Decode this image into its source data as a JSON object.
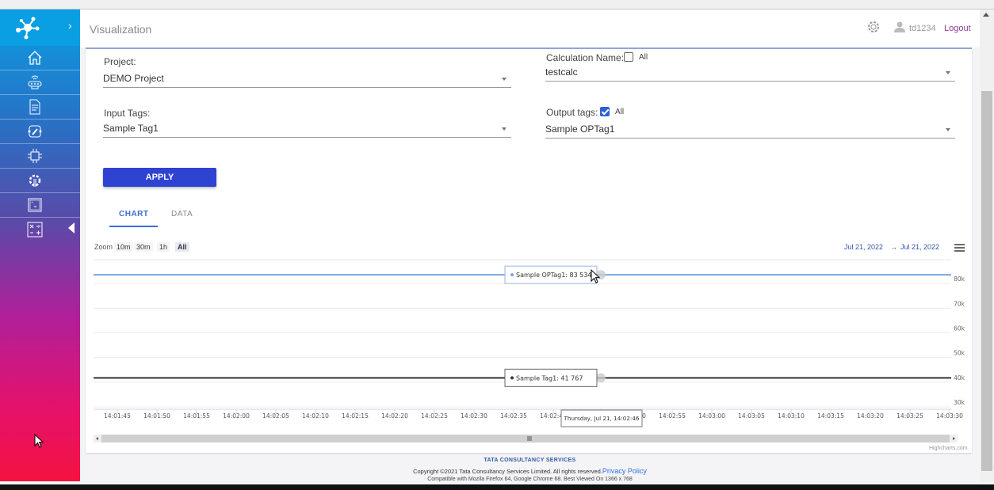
{
  "header": {
    "title": "Visualization",
    "username": "td1234",
    "logout_label": "Logout"
  },
  "sidebar": {
    "items": [
      {
        "icon": "home-icon"
      },
      {
        "icon": "device-icon"
      },
      {
        "icon": "document-icon"
      },
      {
        "icon": "edit-flow-icon"
      },
      {
        "icon": "chip-icon"
      },
      {
        "icon": "settings-tool-icon"
      },
      {
        "icon": "terminal-icon"
      },
      {
        "icon": "calculator-icon"
      }
    ]
  },
  "form": {
    "project": {
      "label": "Project:",
      "value": "DEMO Project"
    },
    "calculation": {
      "label": "Calculation Name:",
      "all_label": "All",
      "all_checked": false,
      "value": "testcalc"
    },
    "input_tags": {
      "label": "Input Tags:",
      "value": "Sample Tag1"
    },
    "output_tags": {
      "label": "Output tags:",
      "all_label": "All",
      "all_checked": true,
      "value": "Sample OPTag1"
    },
    "apply_label": "APPLY"
  },
  "tabs": [
    {
      "label": "CHART",
      "active": true
    },
    {
      "label": "DATA",
      "active": false
    }
  ],
  "chart_toolbar": {
    "zoom_label": "Zoom",
    "zoom_options": [
      "10m",
      "30m",
      "1h",
      "All"
    ],
    "zoom_selected": "All",
    "date_from": "Jul 21, 2022",
    "arrow": "→",
    "date_to": "Jul 21, 2022",
    "credit": "Highcharts.com"
  },
  "chart_data": {
    "type": "line",
    "xlim": [
      "14:01:42",
      "14:03:30"
    ],
    "x_ticks": [
      "14:01:45",
      "14:01:50",
      "14:01:55",
      "14:02:00",
      "14:02:05",
      "14:02:10",
      "14:02:15",
      "14:02:20",
      "14:02:25",
      "14:02:30",
      "14:02:35",
      "14:02:40",
      "14:02:45",
      "14:02:50",
      "14:02:55",
      "14:03:00",
      "14:03:05",
      "14:03:10",
      "14:03:15",
      "14:03:20",
      "14:03:25",
      "14:03:30"
    ],
    "ylim": [
      30000,
      90000
    ],
    "y_ticks": [
      {
        "value": 30000,
        "label": "30k"
      },
      {
        "value": 40000,
        "label": "40k"
      },
      {
        "value": 50000,
        "label": "50k"
      },
      {
        "value": 60000,
        "label": "60k"
      },
      {
        "value": 70000,
        "label": "70k"
      },
      {
        "value": 80000,
        "label": "80k"
      }
    ],
    "grid": true,
    "series": [
      {
        "name": "Sample OPTag1",
        "color": "#7ca3e0",
        "value": 83534,
        "tooltip": "Sample OPTag1: 83 534"
      },
      {
        "name": "Sample Tag1",
        "color": "#333333",
        "value": 41767,
        "tooltip": "Sample Tag1: 41 767"
      }
    ],
    "hover_x": "14:02:46",
    "hover_label": "Thursday, Jul 21, 14:02:46"
  },
  "footer": {
    "brand": "TATA CONSULTANCY SERVICES",
    "copyright": "Copyright ©2021 Tata Consultancy Services Limited. All rights reserved.",
    "privacy": "Privacy Policy",
    "compat": "Compatible with Mozila Firefox 64, Google Chrome 68. Best Viewed On 1366 x 768"
  }
}
